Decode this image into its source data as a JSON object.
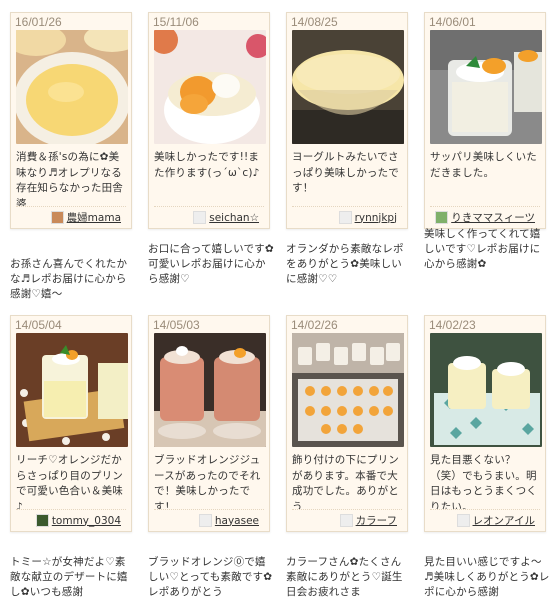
{
  "reports": [
    {
      "date": "16/01/26",
      "caption": "消費＆孫'sの為に✿美味なり♬オレプリなる存在知らなかった田舎婆",
      "author": "農婦mama",
      "reply": "お孫さん喜んでくれたかな♬レポお届けに心から感謝♡嬉～"
    },
    {
      "date": "15/11/06",
      "caption": "美味しかったです!!また作ります(っ´ω`c)♪",
      "author": "seichan☆",
      "reply": "お口に合って嬉しいです✿可愛いレポお届けに心から感謝♡"
    },
    {
      "date": "14/08/25",
      "caption": "ヨーグルトみたいでさっぱり美味しかったです！",
      "author": "rynnjkpj",
      "reply": "オランダから素敵なレポをありがとう✿美味しいに感謝♡♡"
    },
    {
      "date": "14/06/01",
      "caption": "サッパリ美味しくいただきました。",
      "author": "りきママスィーツ",
      "reply": "美味しく作ってくれて嬉しいです♡レポお届けに心から感謝✿"
    },
    {
      "date": "14/05/04",
      "caption": "リーチ♡オレンジだからさっぱり目のプリンで可愛い色合い＆美味♪",
      "author": "tommy_0304",
      "reply": "トミー☆が女神だよ♡素敵な献立のデザートに嬉し✿いつも感謝"
    },
    {
      "date": "14/05/03",
      "caption": "ブラッドオレンジジュースがあったのでそれで！美味しかったです！",
      "author": "hayasee",
      "reply": "ブラッドオレンジ⓪で嬉しい♡とっても素敵です✿レポありがとう"
    },
    {
      "date": "14/02/26",
      "caption": "飾り付けの下にプリンがあります。本番で大成功でした。ありがとう",
      "author": "カラーフ",
      "reply": "カラーフさん✿たくさん素敵にありがとう♡誕生日会お疲れさま"
    },
    {
      "date": "14/02/23",
      "caption": "見た目悪くない？（笑）でもうまい。明日はもっとうまくつくりたい。",
      "author": "レオンアイル",
      "reply": "見た目いい感じですよ～♬美味しくありがとう✿レポに心から感謝"
    }
  ],
  "colors": {
    "card_bg": "#fff8ee",
    "date_text": "#9a8c7a",
    "border": "#e8dcc8"
  }
}
